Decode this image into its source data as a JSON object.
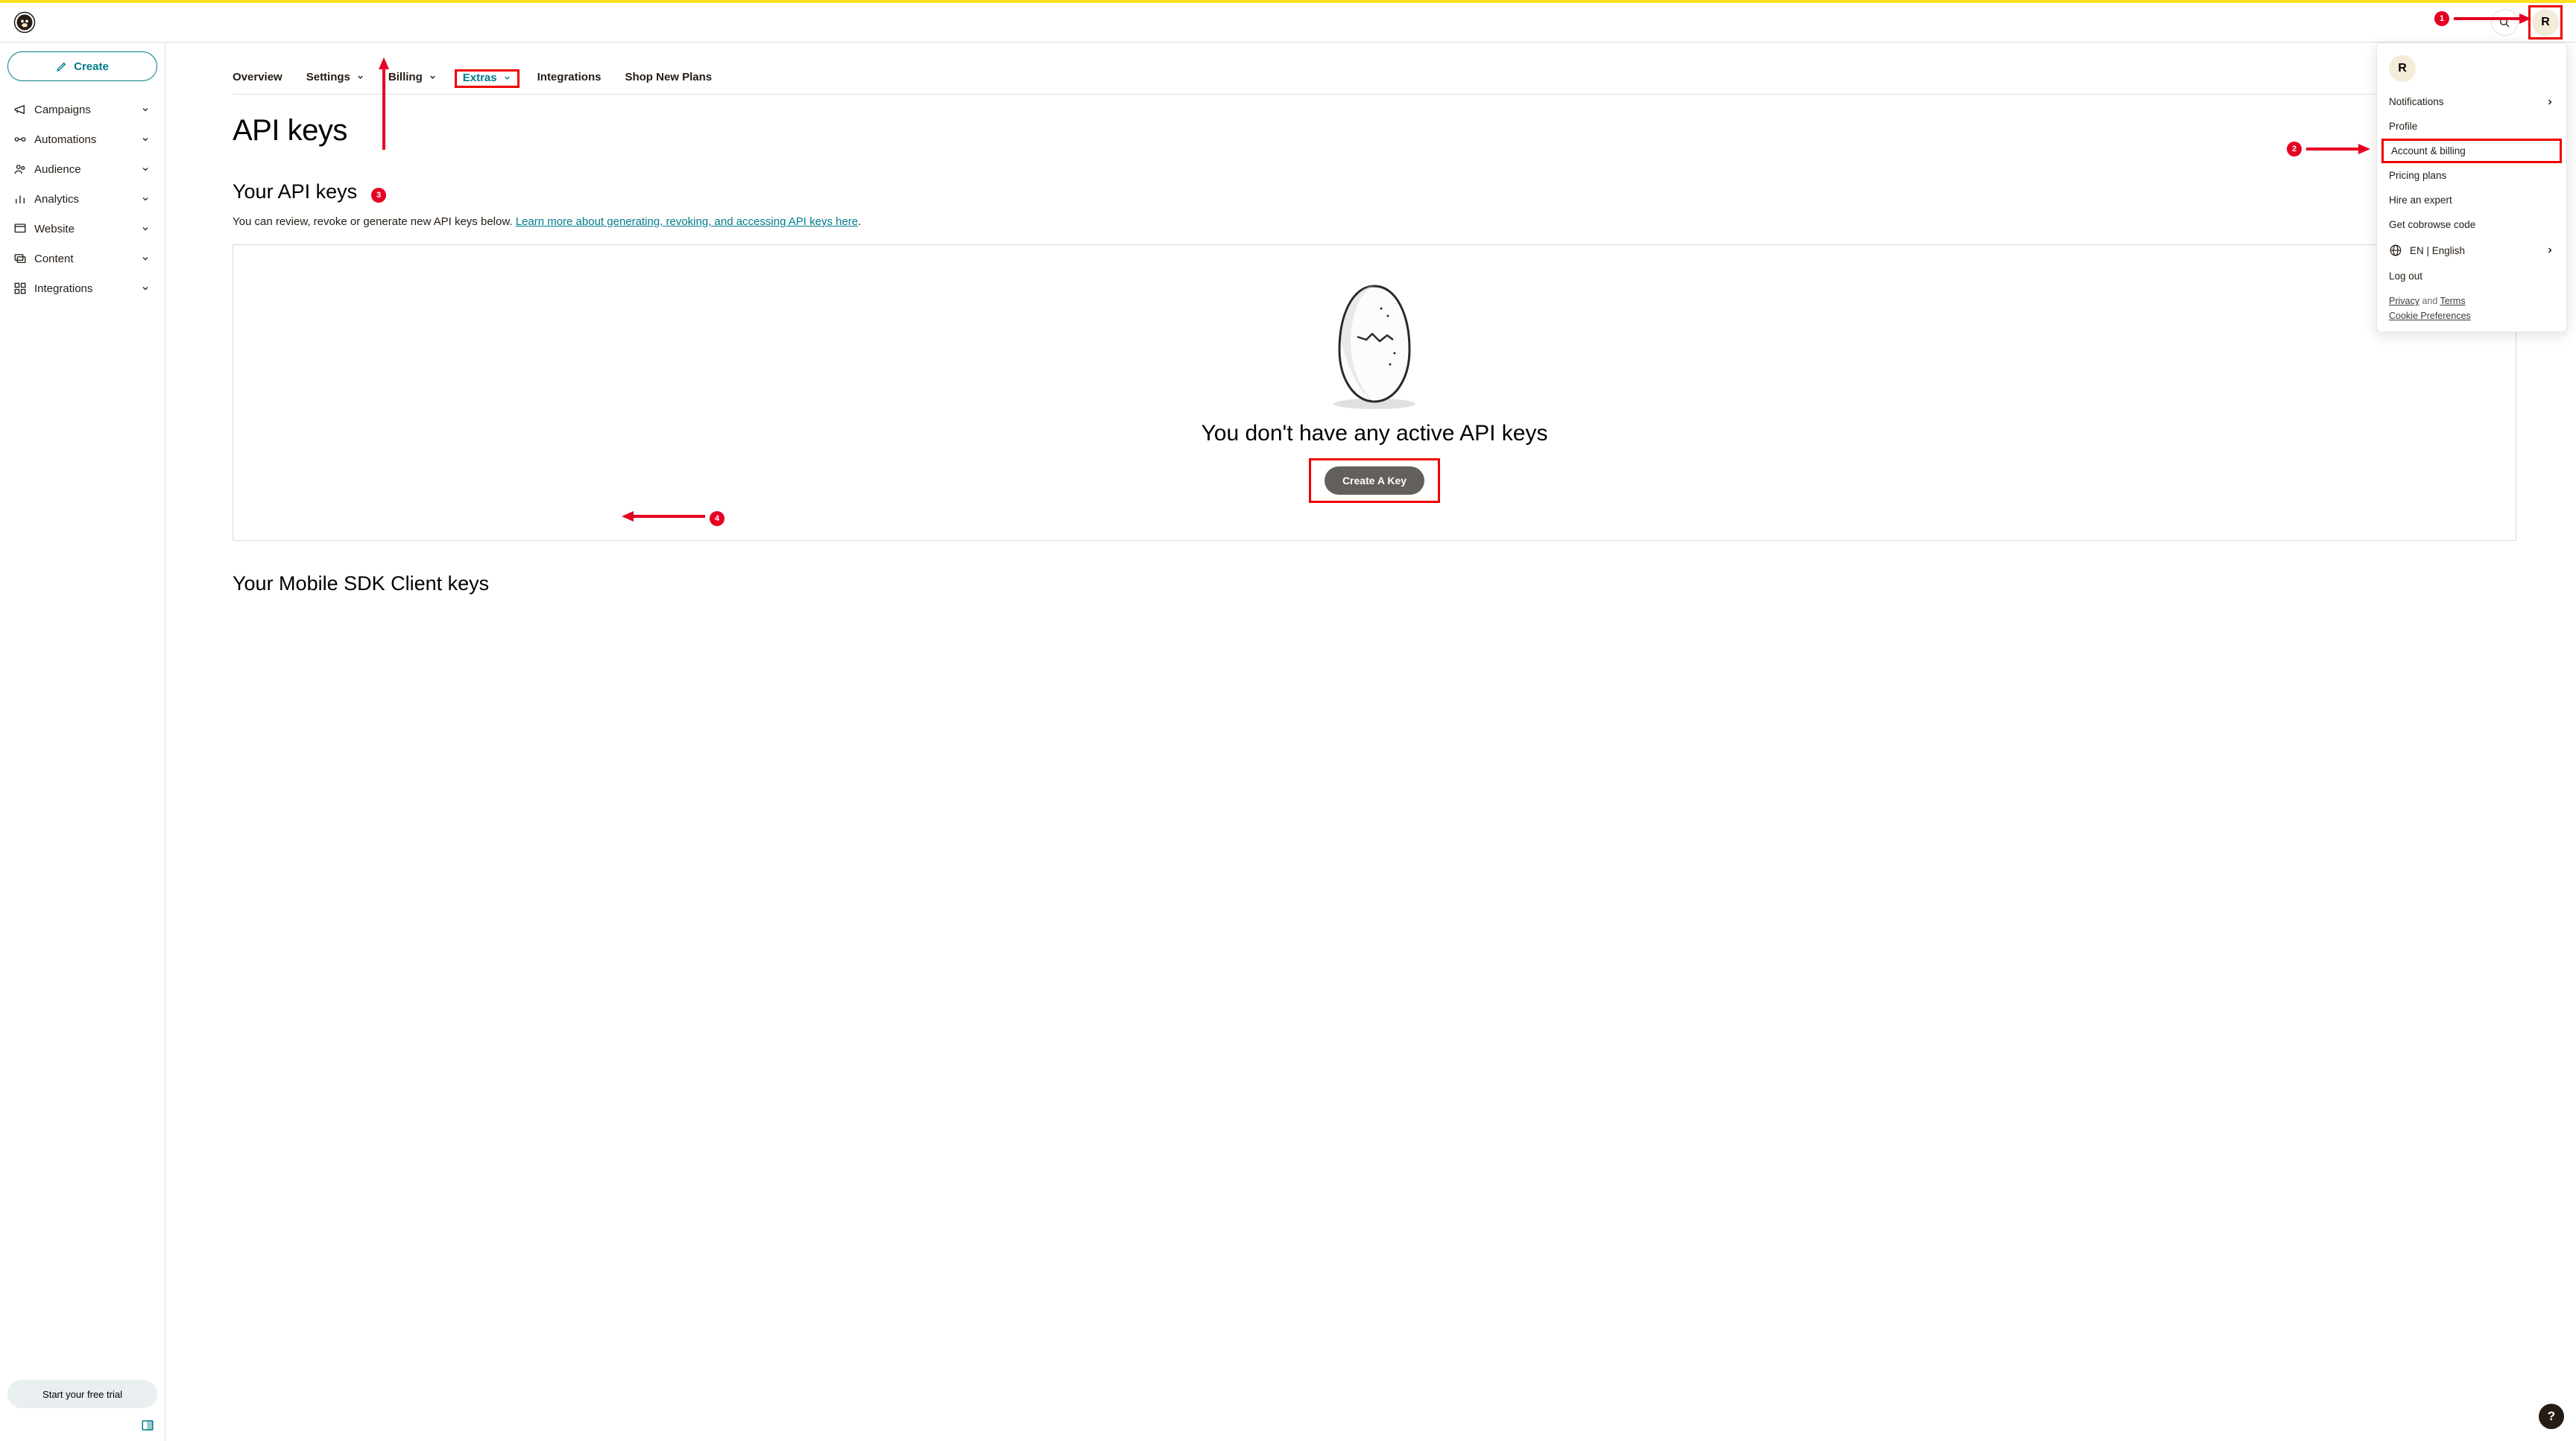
{
  "top": {
    "avatar_letter": "R",
    "create_label": "Create"
  },
  "sidebar": {
    "items": [
      {
        "label": "Campaigns"
      },
      {
        "label": "Automations"
      },
      {
        "label": "Audience"
      },
      {
        "label": "Analytics"
      },
      {
        "label": "Website"
      },
      {
        "label": "Content"
      },
      {
        "label": "Integrations"
      }
    ],
    "trial_label": "Start your free trial"
  },
  "tabs": {
    "overview": "Overview",
    "settings": "Settings",
    "billing": "Billing",
    "extras": "Extras",
    "integrations": "Integrations",
    "shop_plans": "Shop New Plans"
  },
  "page": {
    "title": "API keys",
    "section_title": "Your API keys",
    "desc_pre": "You can review, revoke or generate new API keys below. ",
    "desc_link": "Learn more about generating, revoking, and accessing API keys here",
    "desc_post": ".",
    "empty_heading": "You don't have any active API keys",
    "create_key_label": "Create A Key",
    "mobile_sdk_title": "Your Mobile SDK Client keys"
  },
  "dropdown": {
    "avatar_letter": "R",
    "notifications": "Notifications",
    "profile": "Profile",
    "account_billing": "Account & billing",
    "pricing_plans": "Pricing plans",
    "hire_expert": "Hire an expert",
    "cobrowse": "Get cobrowse code",
    "language": "EN | English",
    "logout": "Log out",
    "privacy": "Privacy",
    "and": " and ",
    "terms": "Terms",
    "cookie_prefs": "Cookie Preferences"
  },
  "callouts": {
    "c1": "1",
    "c2": "2",
    "c3": "3",
    "c4": "4"
  }
}
